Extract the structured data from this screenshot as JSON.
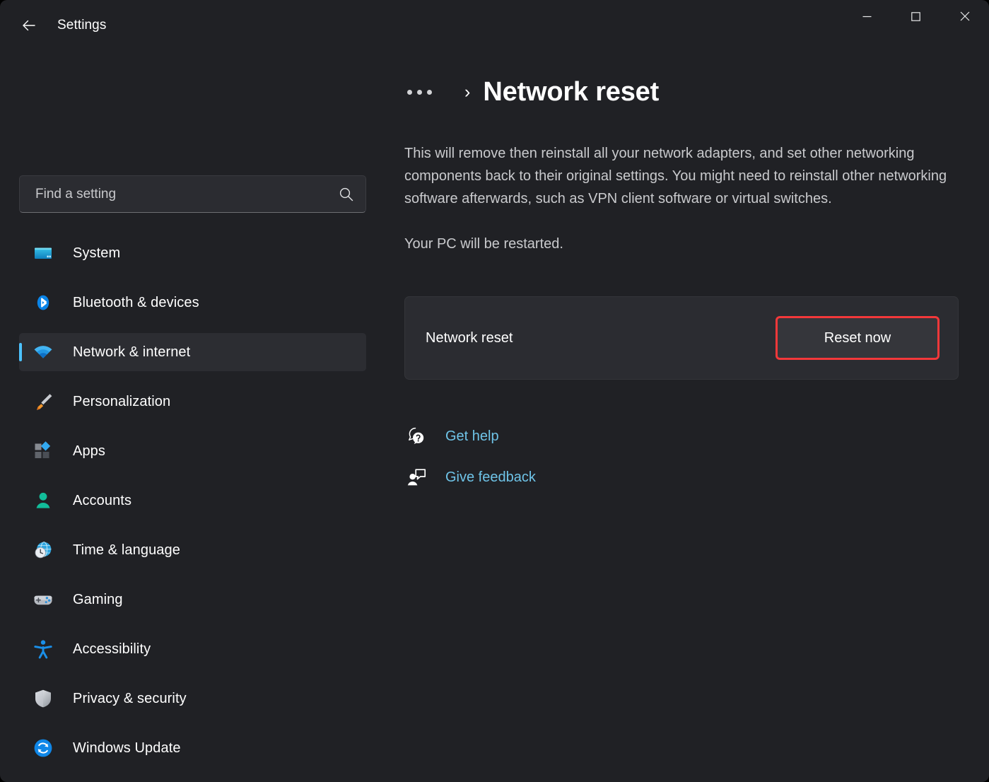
{
  "window": {
    "app_title": "Settings",
    "back_icon": "arrow-left-icon",
    "controls": {
      "minimize": "minimize-icon",
      "maximize": "maximize-icon",
      "close": "close-icon"
    }
  },
  "search": {
    "placeholder": "Find a setting",
    "value": "",
    "icon": "search-icon"
  },
  "sidebar": {
    "items": [
      {
        "label": "System",
        "icon": "monitor-icon",
        "selected": false
      },
      {
        "label": "Bluetooth & devices",
        "icon": "bluetooth-icon",
        "selected": false
      },
      {
        "label": "Network & internet",
        "icon": "wifi-icon",
        "selected": true
      },
      {
        "label": "Personalization",
        "icon": "paintbrush-icon",
        "selected": false
      },
      {
        "label": "Apps",
        "icon": "apps-icon",
        "selected": false
      },
      {
        "label": "Accounts",
        "icon": "person-icon",
        "selected": false
      },
      {
        "label": "Time & language",
        "icon": "clock-globe-icon",
        "selected": false
      },
      {
        "label": "Gaming",
        "icon": "gamepad-icon",
        "selected": false
      },
      {
        "label": "Accessibility",
        "icon": "accessibility-icon",
        "selected": false
      },
      {
        "label": "Privacy & security",
        "icon": "shield-icon",
        "selected": false
      },
      {
        "label": "Windows Update",
        "icon": "update-icon",
        "selected": false
      }
    ]
  },
  "main": {
    "breadcrumb": {
      "ellipsis": "…",
      "separator": "›",
      "title": "Network reset"
    },
    "description": "This will remove then reinstall all your network adapters, and set other networking components back to their original settings. You might need to reinstall other networking software afterwards, such as VPN client software or virtual switches.",
    "restart_note": "Your PC will be restarted.",
    "card": {
      "label": "Network reset",
      "button_label": "Reset now",
      "button_highlight_color": "#f3383a"
    },
    "links": [
      {
        "label": "Get help",
        "icon": "help-bubble-icon"
      },
      {
        "label": "Give feedback",
        "icon": "feedback-person-icon"
      }
    ]
  },
  "colors": {
    "window_bg": "#202125",
    "card_bg": "#2b2c31",
    "accent": "#4cc2ff",
    "link": "#6fc4e8",
    "highlight": "#f3383a"
  }
}
